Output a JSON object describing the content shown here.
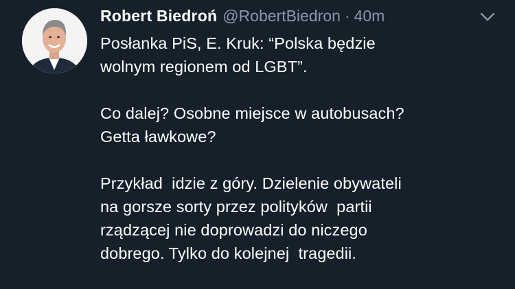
{
  "tweet": {
    "author_name": "Robert Biedroń",
    "handle": "@RobertBiedron",
    "separator": "·",
    "time_ago": "40m",
    "text_lines": [
      "Posłanka PiS, E. Kruk: “Polska będzie",
      "wolnym regionem od LGBT”.",
      "",
      "Co dalej? Osobne miejsce w autobusach?",
      "Getta ławkowe?",
      "",
      "Przykład  idzie z góry. Dzielenie obywateli",
      "na gorsze sorty przez polityków  partii",
      "rządzącej nie doprowadzi do niczego",
      "dobrego. Tylko do kolejnej  tragedii."
    ]
  },
  "icons": {
    "more": "chevron-down-icon",
    "avatar": "profile-photo"
  },
  "colors": {
    "background": "#15202b",
    "text_primary": "#ffffff",
    "text_secondary": "#8899a6"
  }
}
